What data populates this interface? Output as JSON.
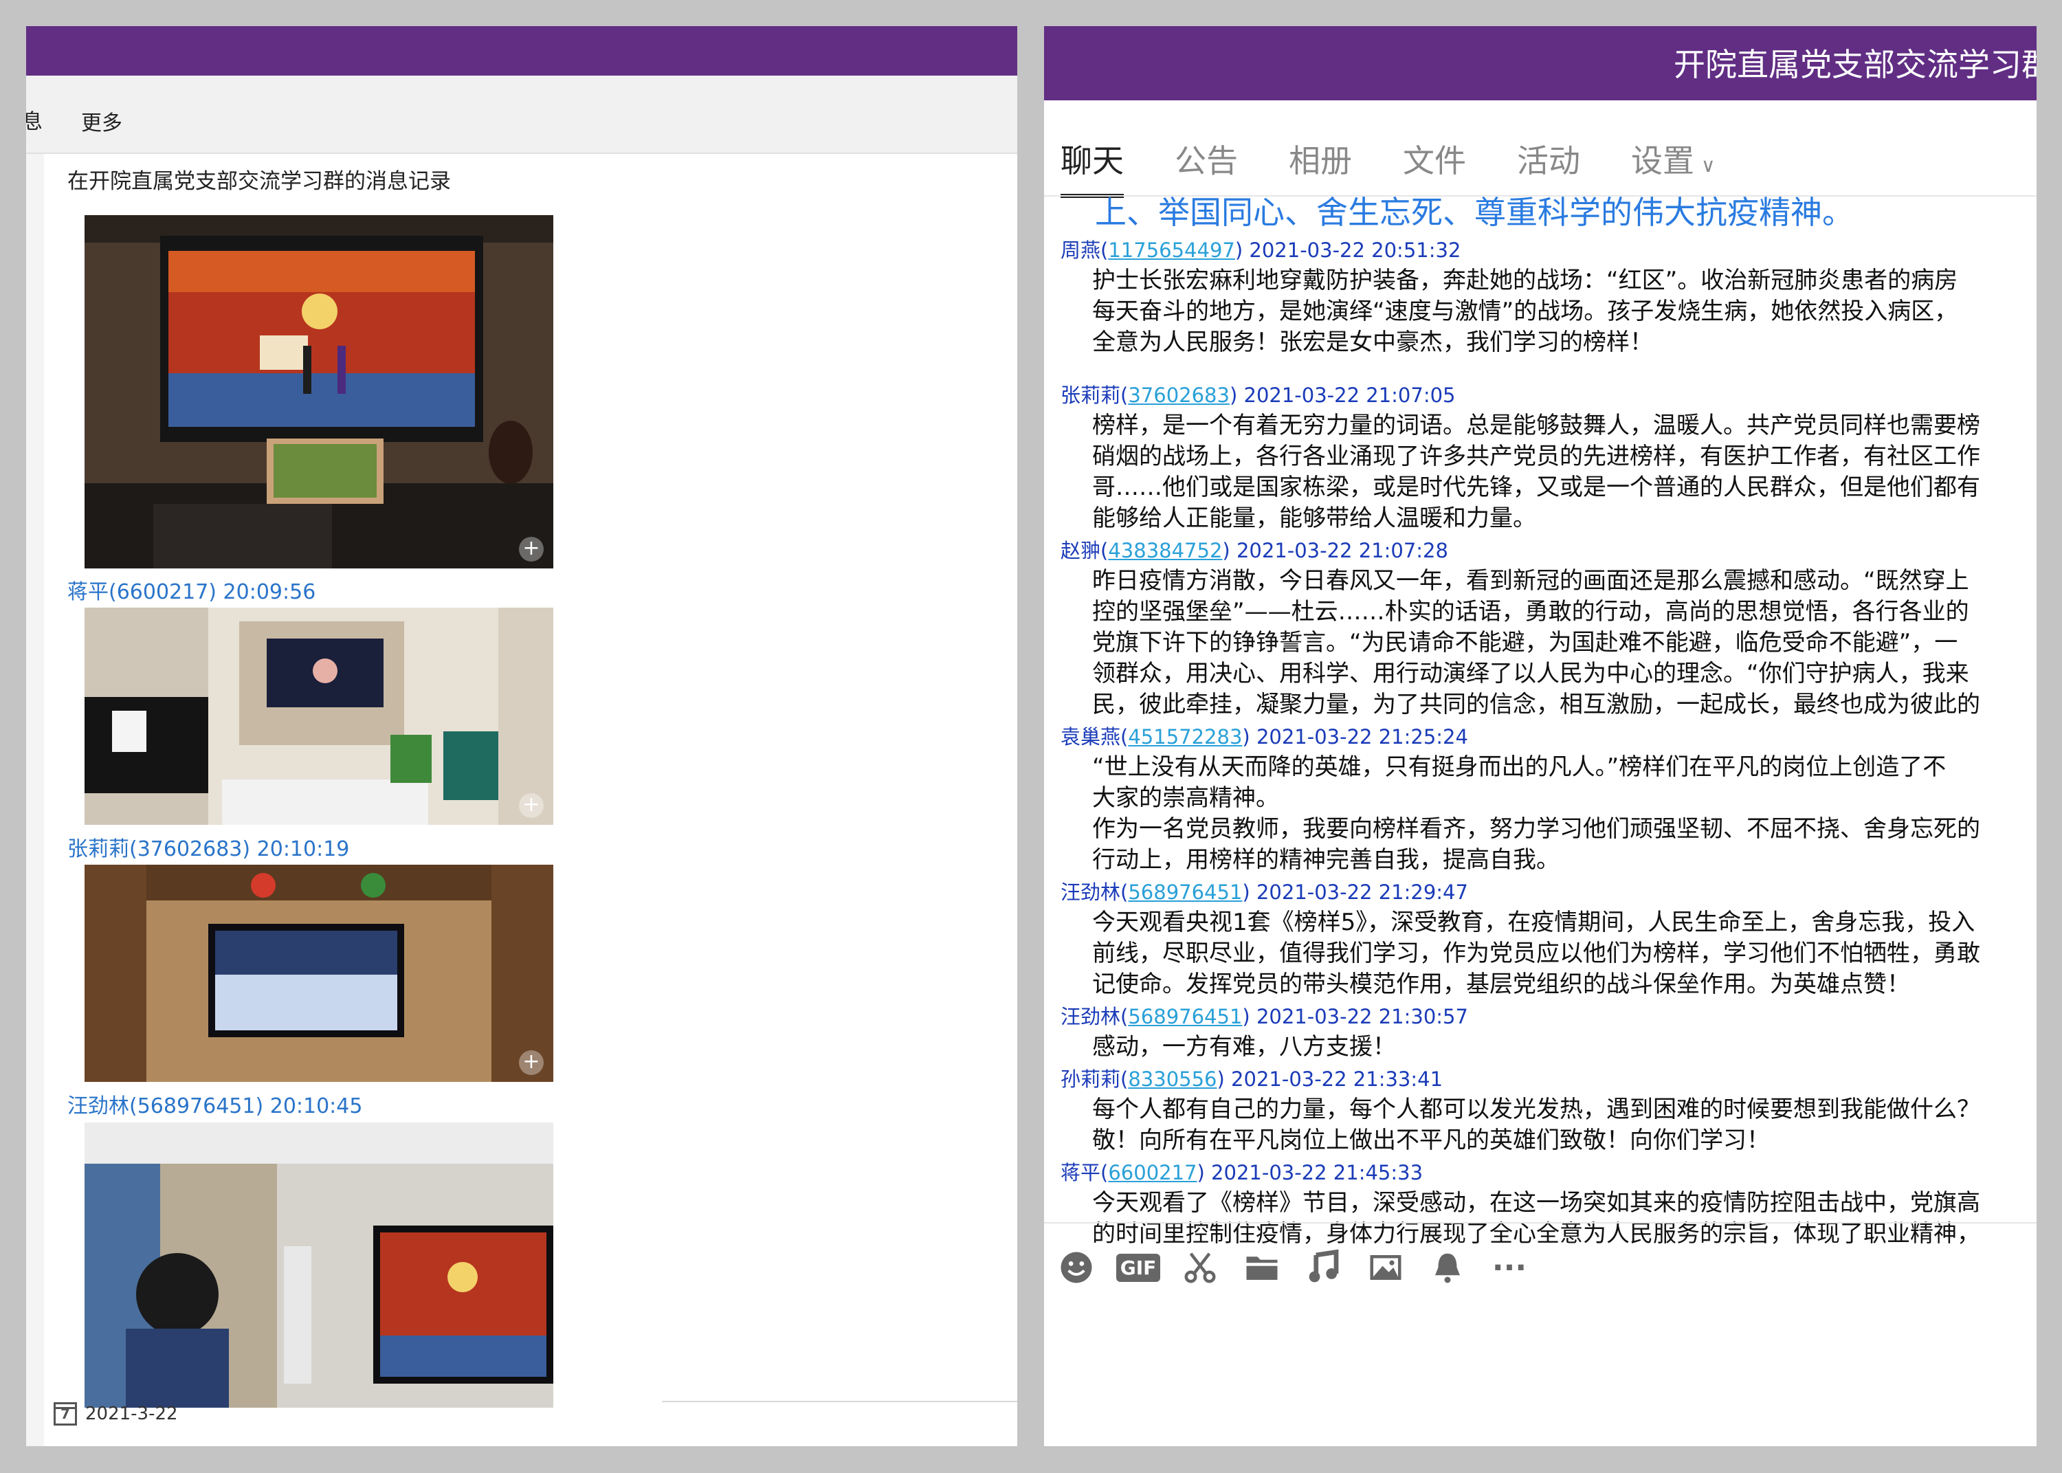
{
  "left": {
    "tabs": {
      "cut_label": "息",
      "more_label": "更多"
    },
    "record_title": "在开院直属党支部交流学习群的消息记录",
    "photos": [
      {
        "caption": "蒋平(6600217) 20:09:56",
        "icon": "plus-icon"
      },
      {
        "caption": "张莉莉(37602683) 20:10:19",
        "icon": "plus-icon"
      },
      {
        "caption": "汪劲林(568976451) 20:10:45",
        "icon": "plus-icon"
      }
    ],
    "date": {
      "icon_text": "7",
      "label": "2021-3-22"
    }
  },
  "right": {
    "group_title": "开院直属党支部交流学习群",
    "tabs": [
      {
        "label": "聊天",
        "active": true
      },
      {
        "label": "公告"
      },
      {
        "label": "相册"
      },
      {
        "label": "文件"
      },
      {
        "label": "活动"
      },
      {
        "label": "设置"
      }
    ],
    "banner": "上、举国同心、舍生忘死、尊重科学的伟大抗疫精神。",
    "messages": [
      {
        "name": "周燕",
        "uid": "1175654497",
        "time": "2021-03-22 20:51:32",
        "lines": [
          "护士长张宏痳利地穿戴防护装备，奔赴她的战场：“红区”。收治新冠肺炎患者的病房",
          "每天奋斗的地方，是她演绎“速度与激情”的战场。孩子发烧生病，她依然投入病区，",
          "全意为人民服务！张宏是女中豪杰，我们学习的榜样！"
        ]
      },
      {
        "name": "张莉莉",
        "uid": "37602683",
        "time": "2021-03-22 21:07:05",
        "lines": [
          "榜样，是一个有着无穷力量的词语。总是能够鼓舞人，温暖人。共产党员同样也需要榜",
          "硝烟的战场上，各行各业涌现了许多共产党员的先进榜样，有医护工作者，有社区工作",
          "哥……他们或是国家栋梁，或是时代先锋，又或是一个普通的人民群众，但是他们都有",
          "能够给人正能量，能够带给人温暖和力量。"
        ]
      },
      {
        "name": "赵翀",
        "uid": "438384752",
        "time": "2021-03-22 21:07:28",
        "lines": [
          "昨日疫情方消散，今日春风又一年，看到新冠的画面还是那么震撼和感动。“既然穿上",
          "控的坚强堡垒”——杜云……朴实的话语，勇敢的行动，高尚的思想觉悟，各行各业的",
          "党旗下许下的铮铮誓言。“为民请命不能避，为国赴难不能避，临危受命不能避”，一",
          "领群众，用决心、用科学、用行动演绎了以人民为中心的理念。“你们守护病人，我来",
          "民，彼此牵挂，凝聚力量，为了共同的信念，相互激励，一起成长，最终也成为彼此的"
        ]
      },
      {
        "name": "袁巢燕",
        "uid": "451572283",
        "time": "2021-03-22 21:25:24",
        "lines": [
          "“世上没有从天而降的英雄，只有挺身而出的凡人。”榜样们在平凡的岗位上创造了不",
          "大家的崇高精神。",
          "作为一名党员教师，我要向榜样看齐，努力学习他们顽强坚韧、不屈不挠、舍身忘死的",
          "行动上，用榜样的精神完善自我，提高自我。"
        ]
      },
      {
        "name": "汪劲林",
        "uid": "568976451",
        "time": "2021-03-22 21:29:47",
        "lines": [
          "今天观看央视1套《榜样5》，深受教育，在疫情期间，人民生命至上，舍身忘我，投入",
          "前线，尽职尽业，值得我们学习，作为党员应以他们为榜样，学习他们不怕牺牲，勇敢",
          "记使命。发挥党员的带头模范作用，基层党组织的战斗保垒作用。为英雄点赞！"
        ]
      },
      {
        "name": "汪劲林",
        "uid": "568976451",
        "time": "2021-03-22 21:30:57",
        "lines": [
          "感动，一方有难，八方支援！"
        ]
      },
      {
        "name": "孙莉莉",
        "uid": "8330556",
        "time": "2021-03-22 21:33:41",
        "lines": [
          "每个人都有自己的力量，每个人都可以发光发热，遇到困难的时候要想到我能做什么？",
          "敬！向所有在平凡岗位上做出不平凡的英雄们致敬！向你们学习！"
        ]
      },
      {
        "name": "蒋平",
        "uid": "6600217",
        "time": "2021-03-22 21:45:33",
        "lines": [
          "今天观看了《榜样》节目，深受感动，在这一场突如其来的疫情防控阻击战中，党旗高",
          "的时间里控制住疫情，身体力行展现了全心全意为人民服务的宗旨，体现了职业精神，"
        ]
      }
    ],
    "toolbar": {
      "gif_label": "GIF",
      "more_label": "···",
      "icons": [
        "smiley-icon",
        "gif-icon",
        "scissors-icon",
        "folder-icon",
        "music-icon",
        "image-icon",
        "bell-icon",
        "more-icon"
      ]
    }
  },
  "colors": {
    "header": "#612e84",
    "link": "#2a74c9",
    "name": "#1a3bb8",
    "uid": "#2aa0d8",
    "banner": "#2a7be0"
  }
}
